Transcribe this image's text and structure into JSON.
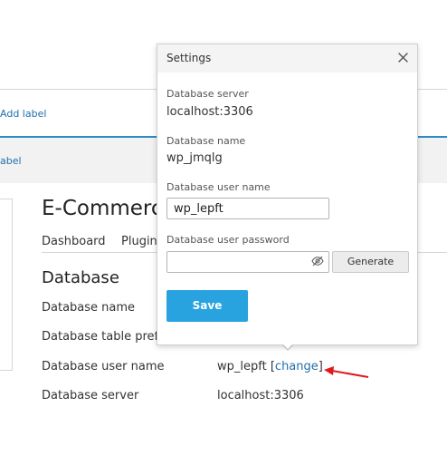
{
  "background": {
    "add_label_top": "Add label",
    "add_label_row": "abel",
    "site_title": "E-Commerce",
    "tabs": [
      "Dashboard",
      "Plugin"
    ],
    "section_heading": "Database",
    "rows": [
      {
        "label": "Database name",
        "value": ""
      },
      {
        "label": "Database table prefix",
        "value": ""
      },
      {
        "label": "Database user name",
        "value": "wp_lepft",
        "link": "change"
      },
      {
        "label": "Database server",
        "value": "localhost:3306"
      }
    ],
    "bracket_open": "[",
    "bracket_close": "]"
  },
  "dialog": {
    "title": "Settings",
    "fields": {
      "db_server_label": "Database server",
      "db_server_value": "localhost:3306",
      "db_name_label": "Database name",
      "db_name_value": "wp_jmqlg",
      "db_user_label": "Database user name",
      "db_user_value": "wp_lepft",
      "db_password_label": "Database user password",
      "db_password_value": ""
    },
    "generate_label": "Generate",
    "save_label": "Save"
  },
  "colors": {
    "accent": "#29a3df",
    "link": "#1f6fad",
    "annotation_arrow": "#e0191c"
  },
  "icons": [
    "close-icon",
    "eye-slash-icon",
    "annotation-arrow"
  ]
}
